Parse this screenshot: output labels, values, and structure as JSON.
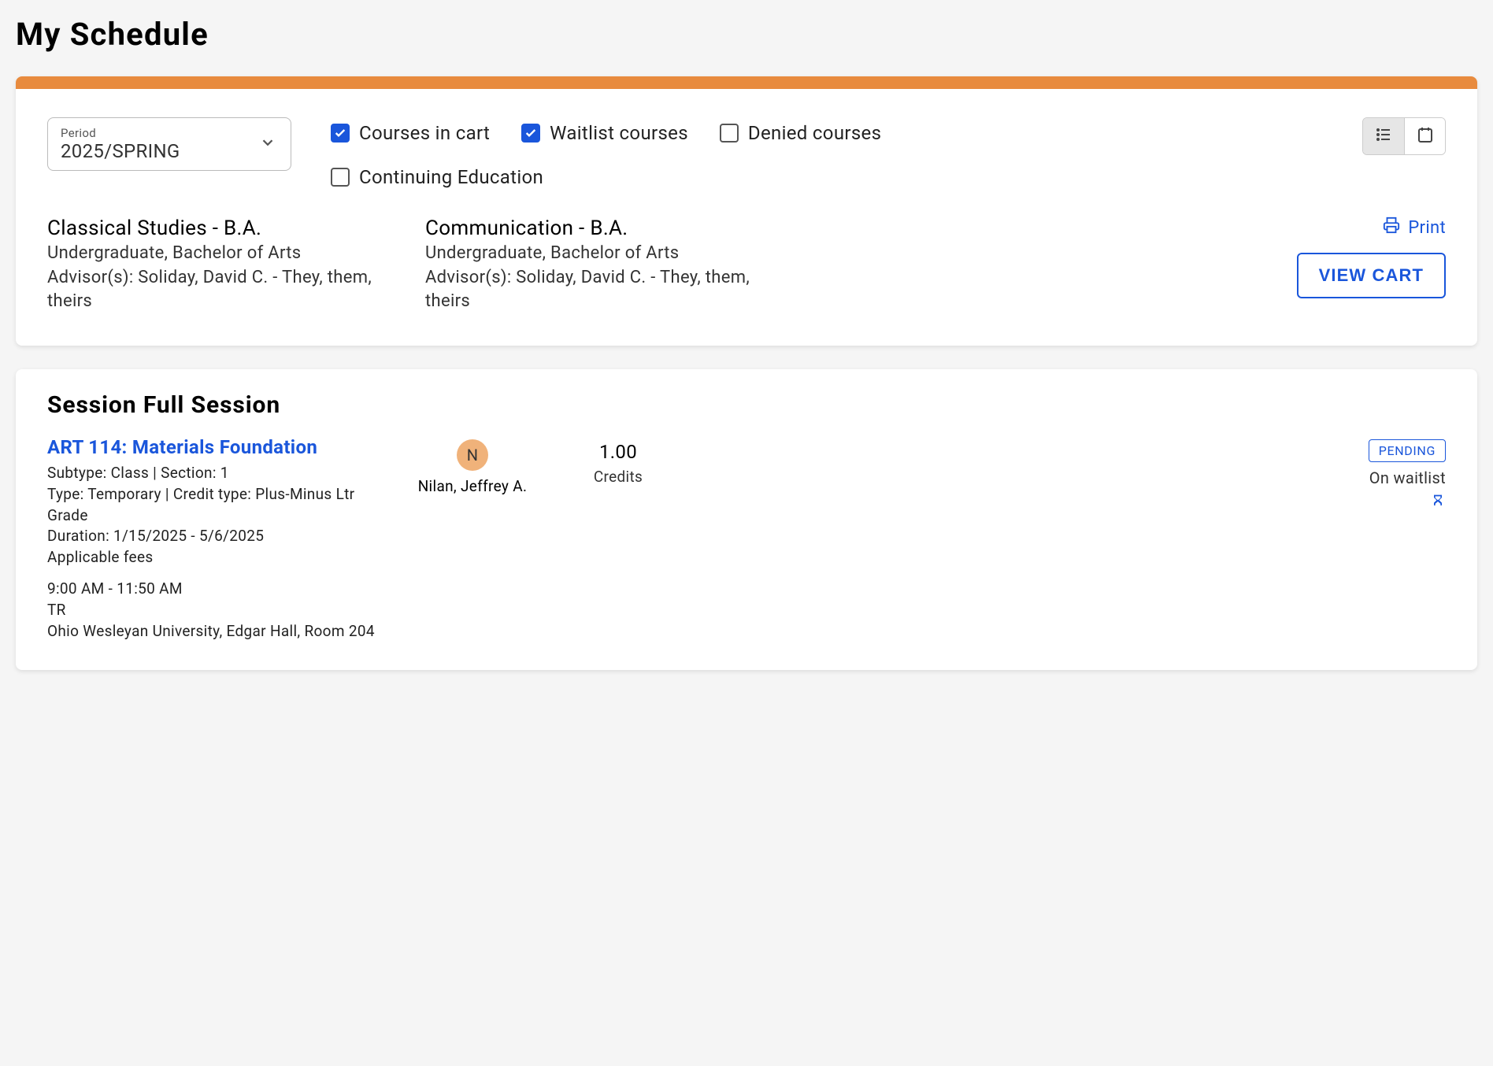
{
  "page_title": "My Schedule",
  "period": {
    "label": "Period",
    "value": "2025/SPRING"
  },
  "filters": {
    "courses_in_cart": {
      "label": "Courses in cart",
      "checked": true
    },
    "waitlist_courses": {
      "label": "Waitlist courses",
      "checked": true
    },
    "denied_courses": {
      "label": "Denied courses",
      "checked": false
    },
    "continuing_education": {
      "label": "Continuing Education",
      "checked": false
    }
  },
  "programs": [
    {
      "title": "Classical Studies - B.A.",
      "subtitle": "Undergraduate, Bachelor of Arts",
      "advisor": "Advisor(s): Soliday, David C. - They, them, theirs"
    },
    {
      "title": "Communication - B.A.",
      "subtitle": "Undergraduate, Bachelor of Arts",
      "advisor": "Advisor(s): Soliday, David C. - They, them, theirs"
    }
  ],
  "actions": {
    "print": "Print",
    "view_cart": "VIEW CART"
  },
  "session": {
    "title": "Session Full Session",
    "course": {
      "title": "ART 114: Materials Foundation",
      "subtype_section": "Subtype: Class | Section: 1",
      "type_credit": "Type: Temporary | Credit type: Plus-Minus Ltr Grade",
      "duration": "Duration: 1/15/2025 - 5/6/2025",
      "fees": "Applicable fees",
      "time": "9:00 AM - 11:50 AM",
      "days": "TR",
      "location": "Ohio Wesleyan University, Edgar Hall, Room 204",
      "instructor_initial": "N",
      "instructor_name": "Nilan, Jeffrey A.",
      "credits_value": "1.00",
      "credits_label": "Credits",
      "status_badge": "PENDING",
      "status_text": "On waitlist"
    }
  }
}
